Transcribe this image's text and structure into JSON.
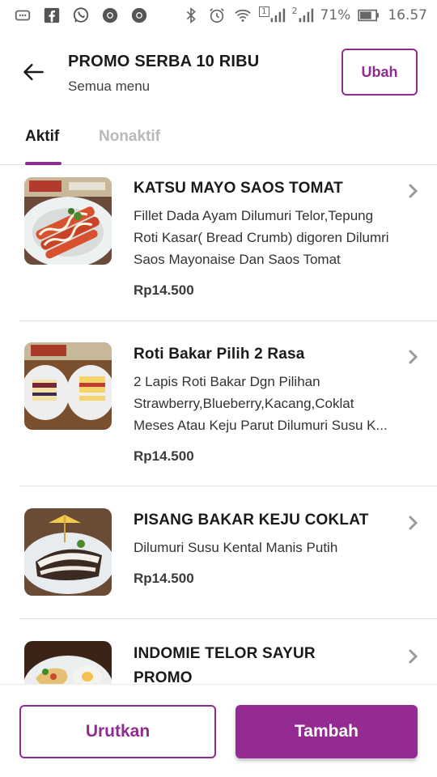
{
  "status_bar": {
    "battery": "71%",
    "time": "16.57",
    "sim1_label": "1",
    "sim2_label": "2",
    "icons_left": [
      "message-icon",
      "facebook-icon",
      "whatsapp-icon",
      "chrome-icon",
      "chrome-icon"
    ],
    "icons_right": [
      "bluetooth-icon",
      "alarm-icon",
      "wifi-icon",
      "signal-icon",
      "signal-icon",
      "battery-icon"
    ]
  },
  "header": {
    "title": "PROMO SERBA 10 RIBU",
    "subtitle": "Semua menu",
    "edit_label": "Ubah"
  },
  "tabs": [
    {
      "label": "Aktif",
      "active": true
    },
    {
      "label": "Nonaktif",
      "active": false
    }
  ],
  "items": [
    {
      "name": "KATSU MAYO SAOS TOMAT",
      "desc": [
        "Fillet Dada Ayam Dilumuri Telor,Tepung",
        "Roti Kasar( Bread Crumb) digoren Dilumri",
        "Saos Mayonaise Dan Saos Tomat"
      ],
      "price": "Rp14.500"
    },
    {
      "name": "Roti Bakar Pilih 2 Rasa",
      "desc": [
        "2 Lapis Roti Bakar Dgn Pilihan",
        "Strawberry,Blueberry,Kacang,Coklat",
        "Meses Atau Keju Parut Dilumuri Susu K..."
      ],
      "price": "Rp14.500"
    },
    {
      "name": "PISANG BAKAR KEJU COKLAT",
      "desc": [
        "Dilumuri Susu Kental Manis Putih"
      ],
      "price": "Rp14.500"
    },
    {
      "name_lines": [
        "INDOMIE TELOR SAYUR",
        "PROMO"
      ]
    }
  ],
  "footer": {
    "sort_label": "Urutkan",
    "add_label": "Tambah"
  },
  "colors": {
    "accent": "#8e2d8f",
    "accent_fill": "#932b93"
  }
}
